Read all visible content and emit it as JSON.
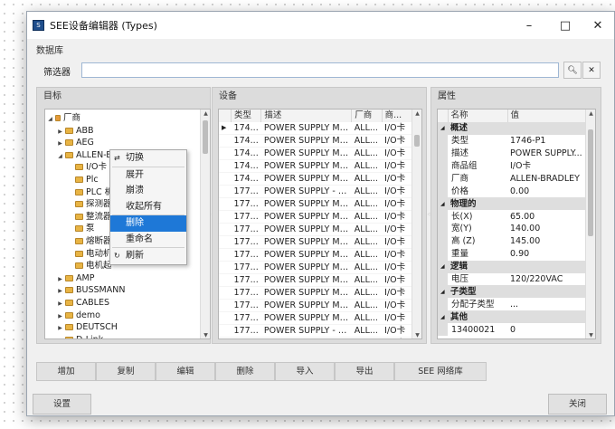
{
  "window": {
    "title": "SEE设备编辑器 (Types)",
    "app_icon": "see-app-icon"
  },
  "database_label": "数据库",
  "filter": {
    "label": "筛选器",
    "value": ""
  },
  "target": {
    "header": "目标",
    "tree": [
      {
        "label": "厂商",
        "level": 0,
        "expanded": true
      },
      {
        "label": "ABB",
        "level": 1
      },
      {
        "label": "AEG",
        "level": 1
      },
      {
        "label": "ALLEN-BRADLEY",
        "level": 1,
        "expanded": true
      },
      {
        "label": "I/O卡",
        "level": 2
      },
      {
        "label": "Plc",
        "level": 2
      },
      {
        "label": "PLC 机",
        "level": 2
      },
      {
        "label": "探测器",
        "level": 2
      },
      {
        "label": "整流器",
        "level": 2
      },
      {
        "label": "泵",
        "level": 2
      },
      {
        "label": "熔断器",
        "level": 2
      },
      {
        "label": "电动机",
        "level": 2
      },
      {
        "label": "电机起",
        "level": 2
      },
      {
        "label": "AMP",
        "level": 1
      },
      {
        "label": "BUSSMANN",
        "level": 1
      },
      {
        "label": "CABLES",
        "level": 1
      },
      {
        "label": "demo",
        "level": 1
      },
      {
        "label": "DEUTSCH",
        "level": 1
      },
      {
        "label": "D-Link",
        "level": 1
      }
    ]
  },
  "context_menu": {
    "items": [
      "切换",
      "展开",
      "崩溃",
      "收起所有",
      "删除",
      "重命名",
      "刷新"
    ],
    "selected": "删除"
  },
  "devices": {
    "header": "设备",
    "columns": [
      "类型",
      "描述",
      "厂商",
      "商..."
    ],
    "rows": [
      [
        "174...",
        "POWER SUPPLY MO...",
        "ALL...",
        "I/O卡"
      ],
      [
        "174...",
        "POWER SUPPLY MO...",
        "ALL...",
        "I/O卡"
      ],
      [
        "174...",
        "POWER SUPPLY MO...",
        "ALL...",
        "I/O卡"
      ],
      [
        "174...",
        "POWER SUPPLY MO...",
        "ALL...",
        "I/O卡"
      ],
      [
        "174...",
        "POWER SUPPLY MO...",
        "ALL...",
        "I/O卡"
      ],
      [
        "177...",
        "POWER SUPPLY - 1...",
        "ALL...",
        "I/O卡"
      ],
      [
        "177...",
        "POWER SUPPLY MO...",
        "ALL...",
        "I/O卡"
      ],
      [
        "177...",
        "POWER SUPPLY MO...",
        "ALL...",
        "I/O卡"
      ],
      [
        "177...",
        "POWER SUPPLY MO...",
        "ALL...",
        "I/O卡"
      ],
      [
        "177...",
        "POWER SUPPLY MO...",
        "ALL...",
        "I/O卡"
      ],
      [
        "177...",
        "POWER SUPPLY MO...",
        "ALL...",
        "I/O卡"
      ],
      [
        "177...",
        "POWER SUPPLY MO...",
        "ALL...",
        "I/O卡"
      ],
      [
        "177...",
        "POWER SUPPLY MO...",
        "ALL...",
        "I/O卡"
      ],
      [
        "177...",
        "POWER SUPPLY MO...",
        "ALL...",
        "I/O卡"
      ],
      [
        "177...",
        "POWER SUPPLY MO...",
        "ALL...",
        "I/O卡"
      ],
      [
        "177...",
        "POWER SUPPLY MO...",
        "ALL...",
        "I/O卡"
      ],
      [
        "177...",
        "POWER SUPPLY - 1...",
        "ALL...",
        "I/O卡"
      ],
      [
        "177...",
        "POWER SUPPLY MO...",
        "ALL...",
        "I/O卡"
      ]
    ]
  },
  "properties": {
    "header": "属性",
    "columns": [
      "名称",
      "值"
    ],
    "rows": [
      {
        "cat": "概述"
      },
      {
        "name": "类型",
        "value": "1746-P1"
      },
      {
        "name": "描述",
        "value": "POWER SUPPLY..."
      },
      {
        "name": "商品组",
        "value": "I/O卡"
      },
      {
        "name": "厂商",
        "value": "ALLEN-BRADLEY"
      },
      {
        "name": "价格",
        "value": "0.00"
      },
      {
        "cat": "物理的"
      },
      {
        "name": "长(X)",
        "value": "65.00"
      },
      {
        "name": "宽(Y)",
        "value": "140.00"
      },
      {
        "name": "高 (Z)",
        "value": "145.00"
      },
      {
        "name": "重量",
        "value": "0.90"
      },
      {
        "cat": "逻辑"
      },
      {
        "name": "电压",
        "value": "120/220VAC"
      },
      {
        "cat": "子类型"
      },
      {
        "name": "分配子类型",
        "value": "..."
      },
      {
        "cat": "其他"
      },
      {
        "name": "13400021",
        "value": "0"
      }
    ]
  },
  "actions": [
    "增加",
    "复制",
    "编辑",
    "删除",
    "导入",
    "导出",
    "SEE 网络库"
  ],
  "footer": {
    "settings": "设置",
    "close": "关闭"
  }
}
